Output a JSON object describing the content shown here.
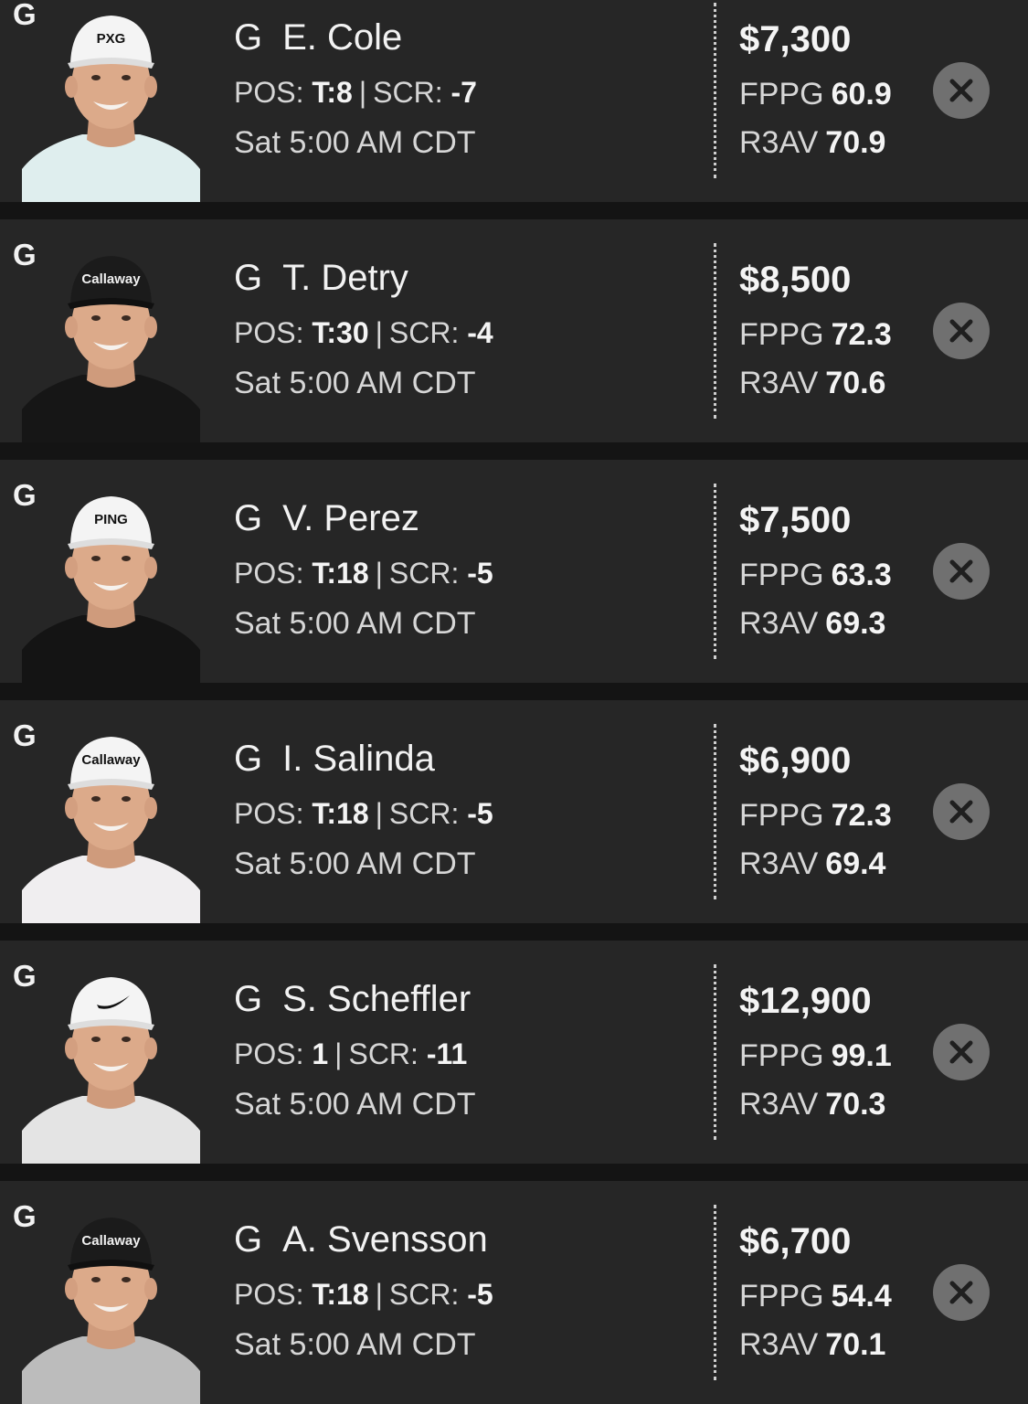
{
  "roster": {
    "players": [
      {
        "slot": "G",
        "position": "G",
        "name": "E. Cole",
        "pos_label": "POS:",
        "pos_value": "T:8",
        "scr_label": "SCR:",
        "scr_value": "-7",
        "separator": "|",
        "time": "Sat 5:00 AM CDT",
        "salary": "$7,300",
        "fppg_label": "FPPG",
        "fppg_value": "60.9",
        "r3av_label": "R3AV",
        "r3av_value": "70.9",
        "photo": {
          "cap": "white",
          "shirt": "#dfeeee",
          "cap_brand": "PXG",
          "cap_text_color": "#111111"
        }
      },
      {
        "slot": "G",
        "position": "G",
        "name": "T. Detry",
        "pos_label": "POS:",
        "pos_value": "T:30",
        "scr_label": "SCR:",
        "scr_value": "-4",
        "separator": "|",
        "time": "Sat 5:00 AM CDT",
        "salary": "$8,500",
        "fppg_label": "FPPG",
        "fppg_value": "72.3",
        "r3av_label": "R3AV",
        "r3av_value": "70.6",
        "photo": {
          "cap": "black",
          "shirt": "#161616",
          "cap_brand": "Callaway",
          "cap_text_color": "#f0f0f0"
        }
      },
      {
        "slot": "G",
        "position": "G",
        "name": "V. Perez",
        "pos_label": "POS:",
        "pos_value": "T:18",
        "scr_label": "SCR:",
        "scr_value": "-5",
        "separator": "|",
        "time": "Sat 5:00 AM CDT",
        "salary": "$7,500",
        "fppg_label": "FPPG",
        "fppg_value": "63.3",
        "r3av_label": "R3AV",
        "r3av_value": "69.3",
        "photo": {
          "cap": "white",
          "shirt": "#141414",
          "cap_brand": "PING",
          "cap_text_color": "#111111"
        }
      },
      {
        "slot": "G",
        "position": "G",
        "name": "I. Salinda",
        "pos_label": "POS:",
        "pos_value": "T:18",
        "scr_label": "SCR:",
        "scr_value": "-5",
        "separator": "|",
        "time": "Sat 5:00 AM CDT",
        "salary": "$6,900",
        "fppg_label": "FPPG",
        "fppg_value": "72.3",
        "r3av_label": "R3AV",
        "r3av_value": "69.4",
        "photo": {
          "cap": "white",
          "shirt": "#f0eef0",
          "cap_brand": "Callaway",
          "cap_text_color": "#111111"
        }
      },
      {
        "slot": "G",
        "position": "G",
        "name": "S. Scheffler",
        "pos_label": "POS:",
        "pos_value": "1",
        "scr_label": "SCR:",
        "scr_value": "-11",
        "separator": "|",
        "time": "Sat 5:00 AM CDT",
        "salary": "$12,900",
        "fppg_label": "FPPG",
        "fppg_value": "99.1",
        "r3av_label": "R3AV",
        "r3av_value": "70.3",
        "photo": {
          "cap": "white",
          "shirt": "#e4e4e4",
          "cap_brand": "",
          "cap_text_color": "#111111"
        }
      },
      {
        "slot": "G",
        "position": "G",
        "name": "A. Svensson",
        "pos_label": "POS:",
        "pos_value": "T:18",
        "scr_label": "SCR:",
        "scr_value": "-5",
        "separator": "|",
        "time": "Sat 5:00 AM CDT",
        "salary": "$6,700",
        "fppg_label": "FPPG",
        "fppg_value": "54.4",
        "r3av_label": "R3AV",
        "r3av_value": "70.1",
        "photo": {
          "cap": "black",
          "shirt": "#bcbcbc",
          "cap_brand": "Callaway",
          "cap_text_color": "#f0f0f0"
        }
      }
    ]
  },
  "colors": {
    "page_background": "#141414",
    "card_background": "#262626",
    "remove_button": "#707070",
    "remove_icon": "#1f1f1f"
  },
  "icons": {
    "remove": "close-icon"
  }
}
